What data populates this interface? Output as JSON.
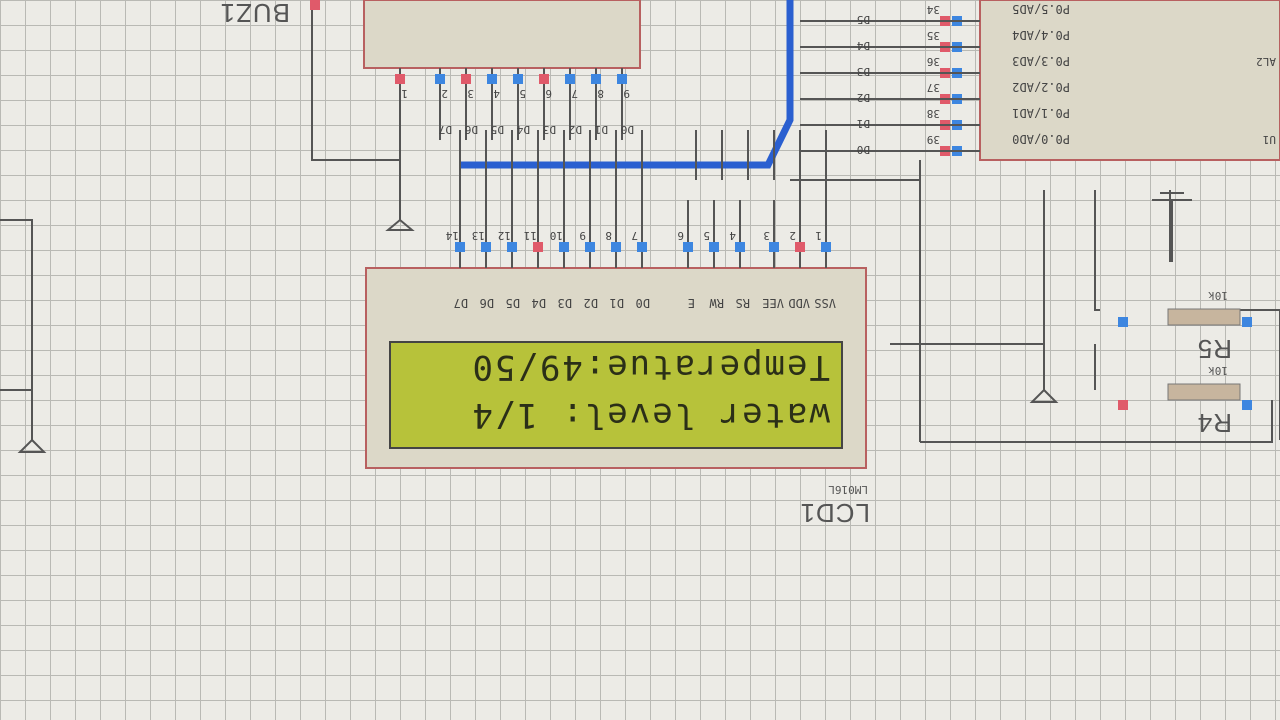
{
  "lcd": {
    "ref": "LCD1",
    "part": "LM016L",
    "line1": "Temperatue:49/50",
    "line2": "water level: 1/4",
    "pin_names": [
      "VSS",
      "VDD",
      "VEE",
      "RS",
      "RW",
      "E",
      "D0",
      "D1",
      "D2",
      "D3",
      "D4",
      "D5",
      "D6",
      "D7"
    ],
    "pin_numbers": [
      "1",
      "2",
      "3",
      "4",
      "5",
      "6",
      "7",
      "8",
      "9",
      "10",
      "11",
      "12",
      "13",
      "14"
    ]
  },
  "buzzer": {
    "ref": "BUZ1"
  },
  "resistors": [
    {
      "ref": "R4",
      "value": "10k"
    },
    {
      "ref": "R5",
      "value": "10k"
    }
  ],
  "mcu": {
    "port_labels": [
      "P0.0/AD0",
      "P0.1/AD1",
      "P0.2/AD2",
      "P0.3/AD3",
      "P0.4/AD4",
      "P0.5/AD5"
    ],
    "pin_numbers": [
      "39",
      "38",
      "37",
      "36",
      "35",
      "34"
    ],
    "partial_labels": [
      "U1",
      "AL2"
    ]
  },
  "header_top": {
    "pin_numbers": [
      "1",
      "2",
      "3",
      "4",
      "5",
      "6",
      "7",
      "8",
      "9"
    ],
    "pin_names": [
      "D0",
      "D1",
      "D2",
      "D3",
      "D4",
      "D5",
      "D6",
      "D7"
    ]
  },
  "bus_labels": [
    "D0",
    "D1",
    "D2",
    "D3",
    "D4",
    "D5"
  ],
  "colors": {
    "grid": "#b9b9b4",
    "lcd_body": "#dcd8c8",
    "lcd_screen": "#b7c23a",
    "bus": "#2a5fd0",
    "pin_red": "#e05a6a",
    "pin_blue": "#3d86e0",
    "wire": "#4b4b4b"
  }
}
